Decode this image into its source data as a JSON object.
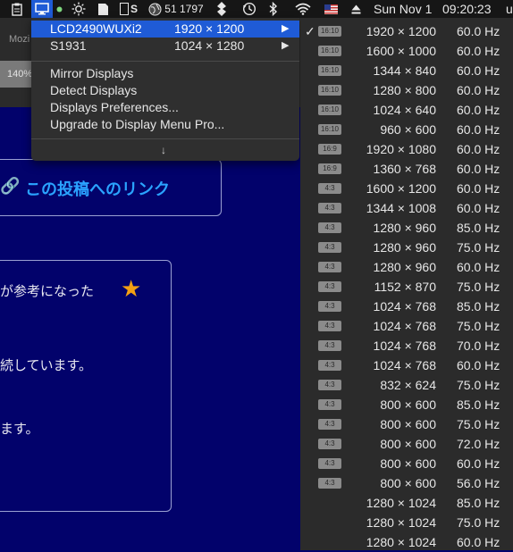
{
  "menubar": {
    "clipboard_icon": "clipboard-icon",
    "display_icon": "display-icon",
    "green_dot_icon": "status-dot-icon",
    "brightness_icon": "brightness-icon",
    "document_icon": "document-icon",
    "s_label": "S",
    "globe_icon": "globe-icon",
    "globe_text": "51 1797",
    "fan_icon": "leaf-icon",
    "time_machine_icon": "time-machine-icon",
    "bluetooth_icon": "bluetooth-icon",
    "wifi_icon": "wifi-icon",
    "flag_icon": "us-flag-icon",
    "eject_icon": "eject-icon",
    "date": "Sun Nov 1",
    "time": "09:20:23",
    "trailing": "u"
  },
  "background": {
    "browser_tab": "Mozi",
    "zoom": "140%",
    "link_text": "この投稿へのリンク",
    "card_heading": "が参考になった",
    "card_line1": "続しています。",
    "card_line2": "ます。"
  },
  "dropdown": {
    "displays": [
      {
        "name": "LCD2490WUXi2",
        "resolution": "1920 × 1200",
        "selected": true
      },
      {
        "name": "S1931",
        "resolution": "1024 × 1280",
        "selected": false
      }
    ],
    "items": [
      "Mirror Displays",
      "Detect Displays",
      "Displays Preferences...",
      "Upgrade to Display Menu Pro..."
    ],
    "more_arrow": "↓"
  },
  "resolutions": [
    {
      "badge": "16:10",
      "res": "1920 × 1200",
      "hz": "60.0 Hz",
      "checked": true
    },
    {
      "badge": "16:10",
      "res": "1600 × 1000",
      "hz": "60.0 Hz"
    },
    {
      "badge": "16:10",
      "res": "1344 × 840",
      "hz": "60.0 Hz"
    },
    {
      "badge": "16:10",
      "res": "1280 × 800",
      "hz": "60.0 Hz"
    },
    {
      "badge": "16:10",
      "res": "1024 × 640",
      "hz": "60.0 Hz"
    },
    {
      "badge": "16:10",
      "res": "960 × 600",
      "hz": "60.0 Hz"
    },
    {
      "badge": "16:9",
      "res": "1920 × 1080",
      "hz": "60.0 Hz"
    },
    {
      "badge": "16:9",
      "res": "1360 × 768",
      "hz": "60.0 Hz"
    },
    {
      "badge": "4:3",
      "res": "1600 × 1200",
      "hz": "60.0 Hz"
    },
    {
      "badge": "4:3",
      "res": "1344 × 1008",
      "hz": "60.0 Hz"
    },
    {
      "badge": "4:3",
      "res": "1280 × 960",
      "hz": "85.0 Hz"
    },
    {
      "badge": "4:3",
      "res": "1280 × 960",
      "hz": "75.0 Hz"
    },
    {
      "badge": "4:3",
      "res": "1280 × 960",
      "hz": "60.0 Hz"
    },
    {
      "badge": "4:3",
      "res": "1152 × 870",
      "hz": "75.0 Hz"
    },
    {
      "badge": "4:3",
      "res": "1024 × 768",
      "hz": "85.0 Hz"
    },
    {
      "badge": "4:3",
      "res": "1024 × 768",
      "hz": "75.0 Hz"
    },
    {
      "badge": "4:3",
      "res": "1024 × 768",
      "hz": "70.0 Hz"
    },
    {
      "badge": "4:3",
      "res": "1024 × 768",
      "hz": "60.0 Hz"
    },
    {
      "badge": "4:3",
      "res": "832 × 624",
      "hz": "75.0 Hz"
    },
    {
      "badge": "4:3",
      "res": "800 × 600",
      "hz": "85.0 Hz"
    },
    {
      "badge": "4:3",
      "res": "800 × 600",
      "hz": "75.0 Hz"
    },
    {
      "badge": "4:3",
      "res": "800 × 600",
      "hz": "72.0 Hz"
    },
    {
      "badge": "4:3",
      "res": "800 × 600",
      "hz": "60.0 Hz"
    },
    {
      "badge": "4:3",
      "res": "800 × 600",
      "hz": "56.0 Hz"
    },
    {
      "badge": "",
      "res": "1280 × 1024",
      "hz": "85.0 Hz"
    },
    {
      "badge": "",
      "res": "1280 × 1024",
      "hz": "75.0 Hz"
    },
    {
      "badge": "",
      "res": "1280 × 1024",
      "hz": "60.0 Hz"
    }
  ],
  "colors": {
    "menubar_bg": "#161616",
    "selection": "#1f5bd6",
    "page_bg": "#02026b",
    "link": "#2aa3ff",
    "star": "#f4a013"
  }
}
